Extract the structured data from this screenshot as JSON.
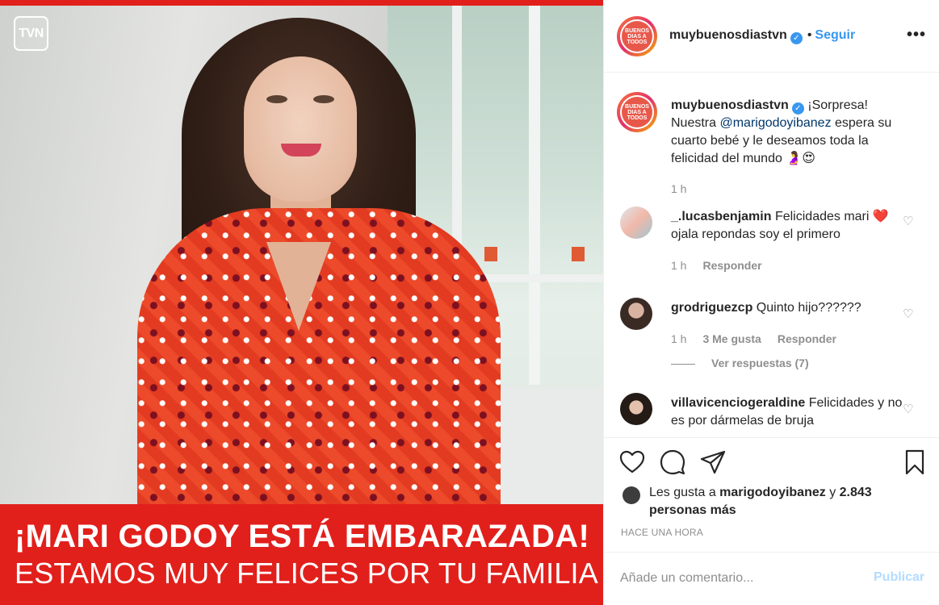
{
  "image": {
    "channel_logo": "TVN",
    "headline": "¡MARI GODOY ESTÁ EMBARAZADA!",
    "subheadline": "ESTAMOS MUY FELICES POR TU FAMILIA"
  },
  "header": {
    "avatar_text": "BUENOS DIAS A TODOS",
    "username": "muybuenosdiastvn",
    "verified": "✓",
    "separator": "•",
    "follow_label": "Seguir",
    "more_label": "•••"
  },
  "caption": {
    "username": "muybuenosdiastvn",
    "text_before": "¡Sorpresa! Nuestra ",
    "mention": "@marigodoyibanez",
    "text_after": " espera su cuarto bebé y le deseamos toda la felicidad del mundo 🤰😍",
    "time": "1 h"
  },
  "comments": [
    {
      "username": "_.lucasbenjamin",
      "text": "Felicidades mari ❤️ ojala repondas soy el primero",
      "time": "1 h",
      "reply_label": "Responder"
    },
    {
      "username": "grodriguezcp",
      "text": "Quinto hijo??????",
      "time": "1 h",
      "likes": "3 Me gusta",
      "reply_label": "Responder",
      "view_replies": "Ver respuestas (7)"
    },
    {
      "username": "villavicencio​geraldine",
      "text": "Felicidades y no es por dármelas de bruja"
    }
  ],
  "actions": {
    "likes_prefix": "Les gusta a ",
    "likes_user": "marigodoyibanez",
    "likes_mid": " y ",
    "likes_count": "2.843 personas más",
    "timestamp": "HACE UNA HORA"
  },
  "composer": {
    "placeholder": "Añade un comentario...",
    "publish_label": "Publicar"
  },
  "colors": {
    "brand_red": "#e1201c",
    "link_blue": "#3897f0",
    "muted_gray": "#8e8e8e"
  }
}
